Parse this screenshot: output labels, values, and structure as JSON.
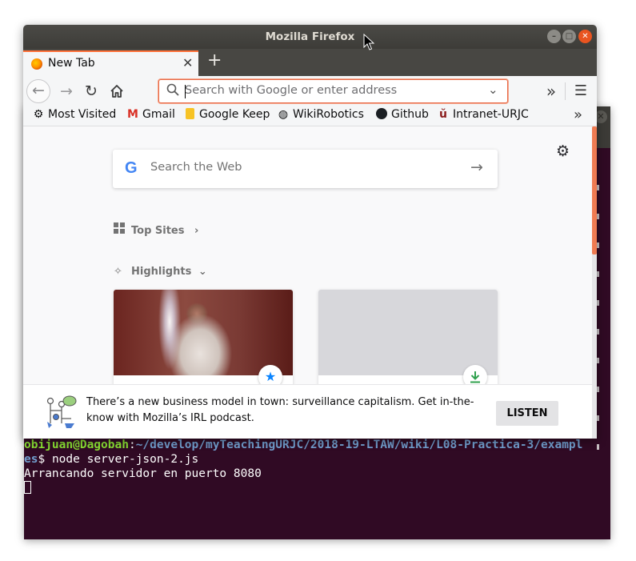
{
  "browser": {
    "window_title": "Mozilla Firefox",
    "tab": {
      "label": "New Tab",
      "close": "✕"
    },
    "new_tab": "+",
    "nav": {
      "back": "←",
      "forward": "→",
      "reload": "↻",
      "home": "⌂",
      "overflow": "»",
      "menu": "☰"
    },
    "urlbar": {
      "placeholder": "Search with Google or enter address",
      "value": "",
      "dropdown": "⌄"
    },
    "bookmarks": [
      {
        "icon": "gear-icon",
        "label": "Most Visited"
      },
      {
        "icon": "gmail-icon",
        "label": "Gmail"
      },
      {
        "icon": "keep-icon",
        "label": "Google Keep"
      },
      {
        "icon": "globe-icon",
        "label": "WikiRobotics"
      },
      {
        "icon": "github-icon",
        "label": "Github"
      },
      {
        "icon": "urjc-icon",
        "label": "Intranet-URJC"
      }
    ],
    "bookmarks_more": "»"
  },
  "newtab": {
    "search_placeholder": "Search the Web",
    "search_arrow": "→",
    "top_sites_title": "Top Sites",
    "highlights_title": "Highlights",
    "chevron_right": "›",
    "chevron_down": "⌄",
    "cards": [
      {
        "image": "person-with-lightsaber",
        "badge_icon": "star-icon"
      },
      {
        "image": "placeholder-gray",
        "badge_icon": "download-icon"
      }
    ],
    "snippet": {
      "text": "There’s a new business model in town: surveillance capitalism. Get in-the-know with Mozilla’s IRL podcast.",
      "button": "LISTEN"
    }
  },
  "terminal": {
    "prompt_user": "obijuan@Dagobah",
    "prompt_sep": ":",
    "prompt_path": "~/develop/myTeachingURJC/2018-19-LTAW/wiki/L08-Practica-3/exampl",
    "prompt_path_cont": "es",
    "prompt_symbol": "$ ",
    "command": "node server-json-2.js",
    "output": "Arrancando servidor en puerto 8080"
  },
  "colors": {
    "accent": "#ff7139",
    "terminal_bg": "#300a24",
    "terminal_user": "#8ae234",
    "terminal_path": "#729fcf",
    "close_button": "#e95420"
  }
}
